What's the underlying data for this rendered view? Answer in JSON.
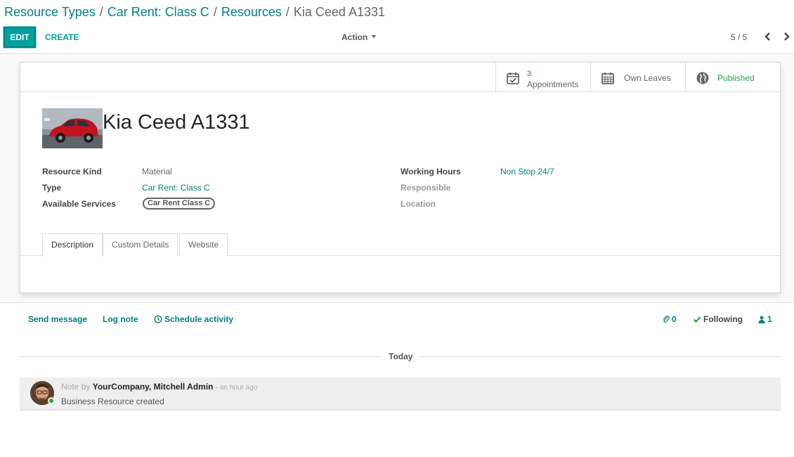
{
  "breadcrumb": {
    "items": [
      "Resource Types",
      "Car Rent: Class C",
      "Resources"
    ],
    "active": "Kia Ceed A1331",
    "separator": "/"
  },
  "toolbar": {
    "edit_label": "EDIT",
    "create_label": "CREATE",
    "action_label": "Action",
    "pager": "5 / 5"
  },
  "stat_buttons": {
    "appointments_count": "3",
    "appointments_label": "Appointments",
    "leaves_label": "Own Leaves",
    "published_label": "Published"
  },
  "record": {
    "title": "Kia Ceed A1331",
    "fields_left": [
      {
        "label": "Resource Kind",
        "value": "Material"
      },
      {
        "label": "Type",
        "value": "Car Rent: Class C"
      },
      {
        "label": "Available Services",
        "value": "Car Rent Class C"
      }
    ],
    "fields_right": [
      {
        "label": "Working Hours",
        "value": "Non Stop 24/7"
      },
      {
        "label": "Responsible",
        "value": ""
      },
      {
        "label": "Location",
        "value": ""
      }
    ]
  },
  "tabs": [
    "Description",
    "Custom Details",
    "Website"
  ],
  "chatter": {
    "send_message": "Send message",
    "log_note": "Log note",
    "schedule_activity": "Schedule activity",
    "attachments_count": "0",
    "following_label": "Following",
    "followers_count": "1",
    "separator_label": "Today",
    "message": {
      "prefix": "Note by",
      "author": "YourCompany, Mitchell Admin",
      "date": "- an hour ago",
      "body": "Business Resource created"
    }
  },
  "colors": {
    "primary": "#00a09d",
    "link": "#017e84",
    "published": "#28a745",
    "stat_number": "#8f3a84"
  }
}
